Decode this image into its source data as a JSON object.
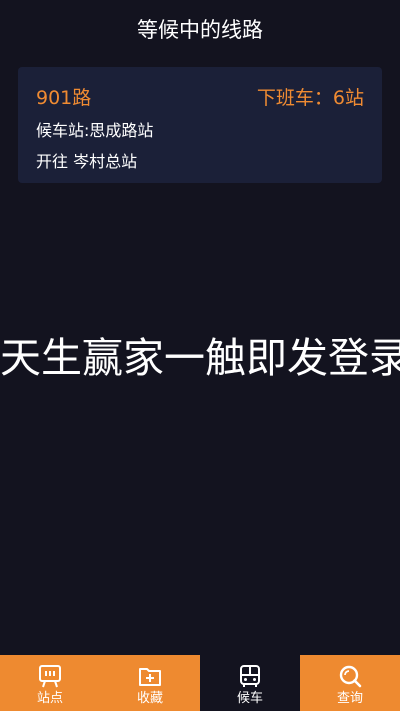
{
  "header": {
    "title": "等候中的线路"
  },
  "card": {
    "route_name": "901路",
    "next_bus": "下班车：6站",
    "wait_station": "候车站:思成路站",
    "direction": "开往 岑村总站"
  },
  "overlay": {
    "text": "天生赢家一触即发登录"
  },
  "tabbar": {
    "tabs": [
      {
        "label": "站点",
        "icon": "station-sign-icon",
        "active": false
      },
      {
        "label": "收藏",
        "icon": "folder-plus-icon",
        "active": false
      },
      {
        "label": "候车",
        "icon": "bus-icon",
        "active": true
      },
      {
        "label": "查询",
        "icon": "search-icon",
        "active": false
      }
    ]
  },
  "colors": {
    "background": "#13131f",
    "card": "#1b2038",
    "accent": "#f08b32",
    "tab_orange": "#ee8a30"
  }
}
